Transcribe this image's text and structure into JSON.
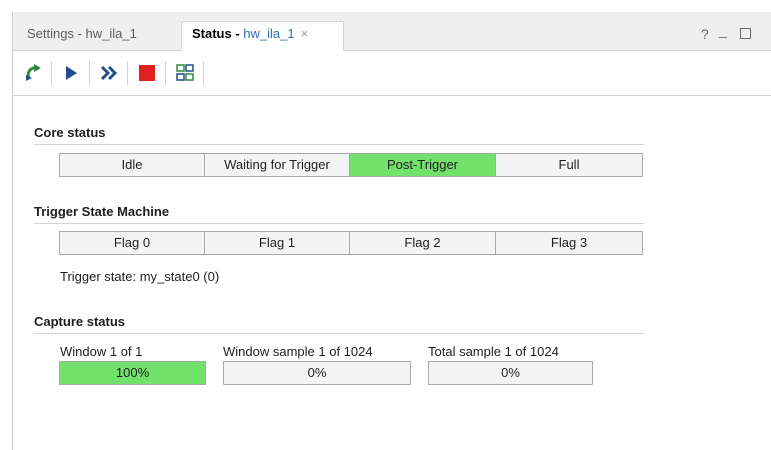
{
  "tabs": {
    "inactive_label": "Settings - hw_ila_1",
    "active_prefix": "Status - ",
    "active_name": "hw_ila_1",
    "close_glyph": "×"
  },
  "window_controls": {
    "help": "?",
    "minimize": "_"
  },
  "toolbar": {
    "buttons": [
      "run-trigger-immediate-icon",
      "run-trigger-icon",
      "run-repeat-icon",
      "stop-icon",
      "toggle-settings-icon"
    ],
    "accent_green": "#2d8a3e",
    "accent_blue": "#1f4f8f",
    "stop_color": "#e0211f"
  },
  "core_status": {
    "title": "Core status",
    "segments": [
      "Idle",
      "Waiting for Trigger",
      "Post-Trigger",
      "Full"
    ],
    "active_index": 2
  },
  "trigger_state_machine": {
    "title": "Trigger State Machine",
    "flags": [
      "Flag 0",
      "Flag 1",
      "Flag 2",
      "Flag 3"
    ],
    "state_text": "Trigger state: my_state0 (0)"
  },
  "capture_status": {
    "title": "Capture status",
    "items": [
      {
        "label": "Window 1 of 1",
        "percent_text": "100%",
        "fraction": 1.0
      },
      {
        "label": "Window sample 1 of 1024",
        "percent_text": "0%",
        "fraction": 0.0
      },
      {
        "label": "Total sample 1 of 1024",
        "percent_text": "0%",
        "fraction": 0.0
      }
    ]
  },
  "colors": {
    "active_green": "#73e26d",
    "tab_blue": "#2f6db8"
  }
}
